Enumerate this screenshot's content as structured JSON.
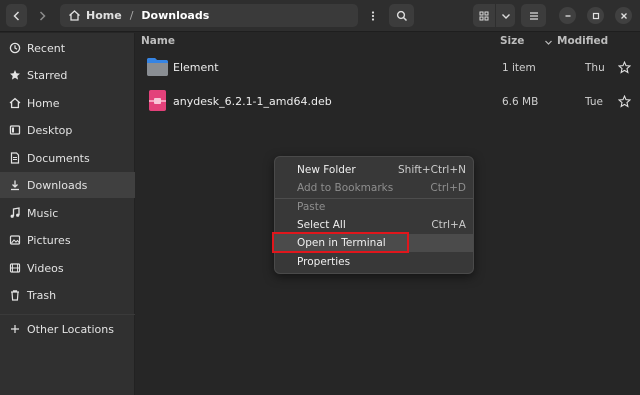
{
  "header": {
    "path": [
      "Home",
      "Downloads"
    ]
  },
  "sidebar": {
    "items": [
      {
        "label": "Recent",
        "icon": "clock-icon"
      },
      {
        "label": "Starred",
        "icon": "star-icon"
      },
      {
        "label": "Home",
        "icon": "home-icon"
      },
      {
        "label": "Desktop",
        "icon": "desktop-icon"
      },
      {
        "label": "Documents",
        "icon": "document-icon"
      },
      {
        "label": "Downloads",
        "icon": "download-icon",
        "active": true
      },
      {
        "label": "Music",
        "icon": "music-icon"
      },
      {
        "label": "Pictures",
        "icon": "picture-icon"
      },
      {
        "label": "Videos",
        "icon": "video-icon"
      },
      {
        "label": "Trash",
        "icon": "trash-icon"
      },
      {
        "label": "Other Locations",
        "icon": "plus-icon"
      }
    ]
  },
  "list": {
    "columns": {
      "name": "Name",
      "size": "Size",
      "modified": "Modified"
    },
    "rows": [
      {
        "name": "Element",
        "size": "1 item",
        "modified": "Thu",
        "icon": "folder-icon"
      },
      {
        "name": "anydesk_6.2.1-1_amd64.deb",
        "size": "6.6 MB",
        "modified": "Tue",
        "icon": "package-icon"
      }
    ]
  },
  "context_menu": {
    "items": [
      {
        "label": "New Folder",
        "accel": "Shift+Ctrl+N"
      },
      {
        "label": "Add to Bookmarks",
        "accel": "Ctrl+D",
        "disabled": true
      },
      {
        "label": "Paste",
        "accel": "",
        "disabled": true
      },
      {
        "label": "Select All",
        "accel": "Ctrl+A"
      },
      {
        "label": "Open in Terminal",
        "accel": "",
        "highlighted": true
      },
      {
        "label": "Properties",
        "accel": ""
      }
    ]
  },
  "colors": {
    "highlight_box": "#e0161c",
    "folder_blue": "#3584e4",
    "package_pink": "#e3417a"
  }
}
